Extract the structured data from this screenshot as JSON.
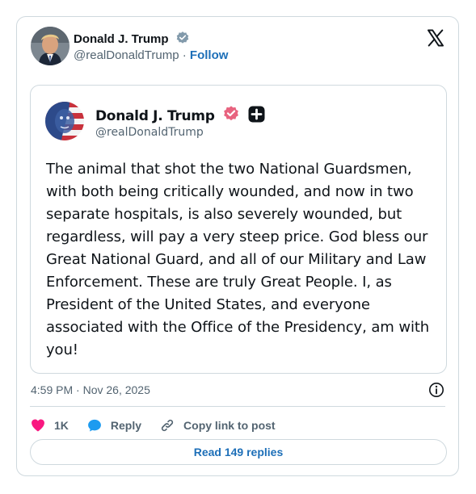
{
  "author": {
    "name": "Donald J. Trump",
    "handle": "@realDonaldTrump",
    "separator": "·",
    "follow_label": "Follow"
  },
  "quoted_post": {
    "name": "Donald J. Trump",
    "handle": "@realDonaldTrump",
    "text": "The animal that shot the two National Guardsmen, with both being critically wounded, and now in two separate hospitals, is also severely wounded, but regardless, will pay a very steep price. God bless our Great National Guard, and all of our Military and Law Enforcement. These are truly Great People. I, as President of the United States, and everyone associated with the Office of the Presidency, am with you!"
  },
  "timestamp": "4:59 PM · Nov 26, 2025",
  "actions": {
    "like_count": "1K",
    "reply_label": "Reply",
    "copy_link_label": "Copy link to post"
  },
  "read_replies_label": "Read 149 replies",
  "icons": {
    "verified": "verified-badge-icon",
    "x_logo": "x-logo-icon",
    "info": "info-icon",
    "heart": "heart-icon",
    "reply": "reply-bubble-icon",
    "link": "link-icon",
    "plus": "plus-badge-icon"
  },
  "colors": {
    "link_blue": "#1d6fb8",
    "verified_blue": "#829aab",
    "heart_pink": "#f91880",
    "reply_blue": "#1d9bf0",
    "truth_badge_pink": "#e8637f",
    "text_muted": "#536471",
    "border": "#cfd9de"
  }
}
